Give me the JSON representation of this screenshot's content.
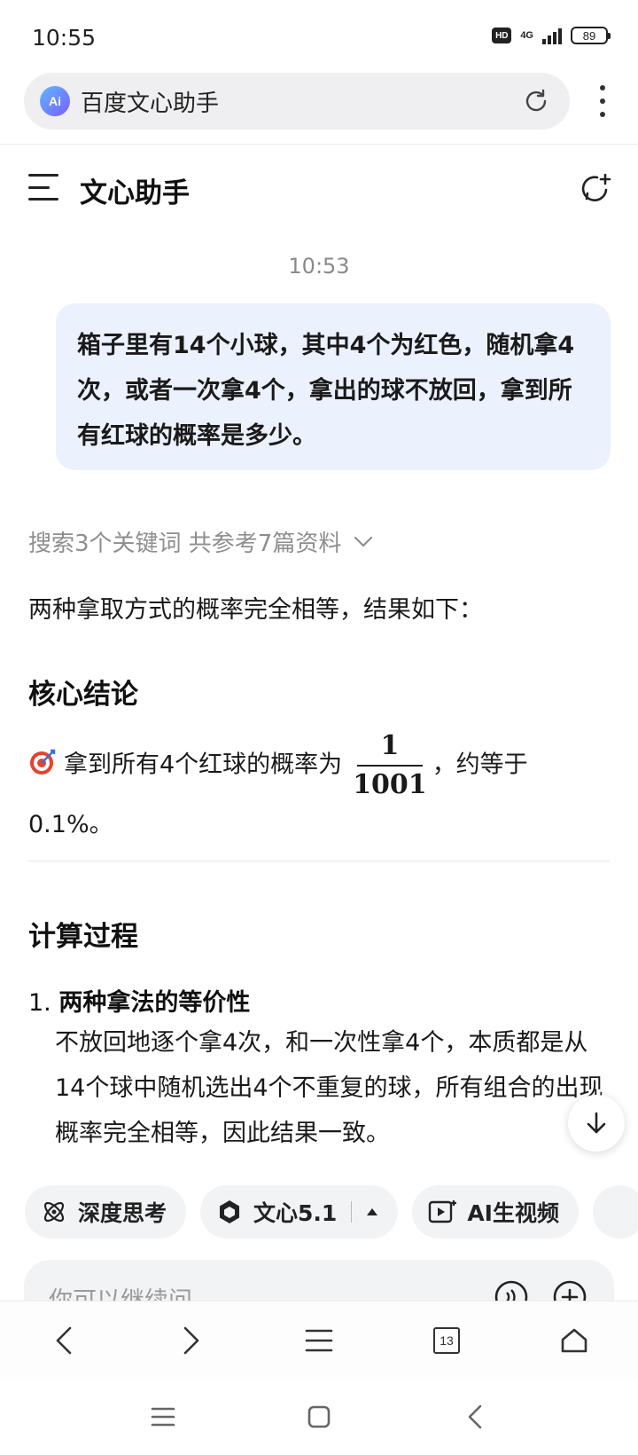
{
  "status": {
    "time": "10:55",
    "hd": "HD",
    "network": "4G",
    "battery": "89"
  },
  "browser": {
    "url_title": "百度文心助手",
    "logo_text": "Ai",
    "tab_count": "13"
  },
  "app": {
    "title": "文心助手"
  },
  "chat": {
    "timestamp": "10:53",
    "user_message": "箱子里有14个小球，其中4个为红色，随机拿4次，或者一次拿4个，拿出的球不放回，拿到所有红球的概率是多少。",
    "search_ref": "搜索3个关键词 共参考7篇资料",
    "intro": "两种拿取方式的概率完全相等，结果如下：",
    "core_heading": "核心结论",
    "conclusion_before": "拿到所有4个红球的概率为",
    "fraction_num": "1",
    "fraction_den": "1001",
    "conclusion_after": "，约等于0.1%。",
    "calc_heading": "计算过程",
    "step1_number": "1.",
    "step1_title": "两种拿法的等价性",
    "step1_body": "不放回地逐个拿4次，和一次性拿4个，本质都是从14个球中随机选出4个不重复的球，所有组合的出现概率完全相等，因此结果一致。"
  },
  "chips": {
    "deep_think": "深度思考",
    "model": "文心5.1",
    "ai_video": "AI生视频"
  },
  "input": {
    "placeholder": "你可以继续问"
  },
  "colors": {
    "bubble_bg": "#ecf1fe",
    "accent": "#4e6ef2",
    "target_red": "#e8412f"
  }
}
